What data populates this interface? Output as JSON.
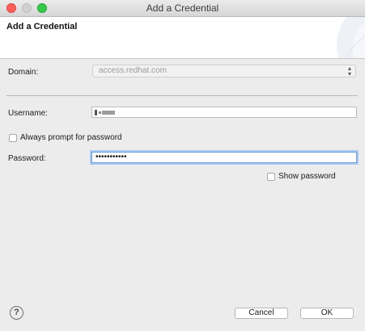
{
  "window": {
    "title": "Add a Credential"
  },
  "banner": {
    "title": "Add a Credential"
  },
  "form": {
    "domain_label": "Domain:",
    "domain_value": "access.redhat.com",
    "username_label": "Username:",
    "username_value": "",
    "always_prompt_label": "Always prompt for password",
    "always_prompt_checked": false,
    "password_label": "Password:",
    "password_value": "•••••••••••",
    "show_password_label": "Show password",
    "show_password_checked": false
  },
  "buttons": {
    "cancel": "Cancel",
    "ok": "OK",
    "help": "?"
  },
  "icons": {
    "window_close": "close-icon",
    "window_minimize": "minimize-icon",
    "window_maximize": "maximize-icon",
    "select_arrows": "chevron-up-down-icon",
    "help": "help-icon"
  },
  "colors": {
    "focus": "#6f9fdc",
    "close": "#fc5f57",
    "maximize": "#35c84a"
  }
}
